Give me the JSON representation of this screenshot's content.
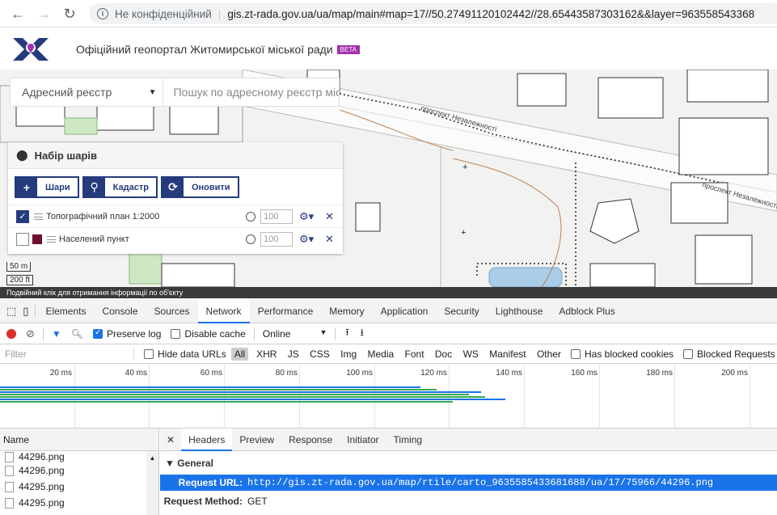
{
  "browser": {
    "security_label": "Не конфіденційний",
    "url": "gis.zt-rada.gov.ua/ua/map/main#map=17//50.27491120102442//28.65443587303162&&layer=963558543368"
  },
  "header": {
    "title": "Офіційний геопортал Житомирської міської ради",
    "badge": "BETA"
  },
  "map": {
    "register_select": "Адресний реєстр",
    "search_placeholder": "Пошук по адресному реєстр міс",
    "street_labels": [
      "проспект Незалежності",
      "проспект Незалежності"
    ],
    "layers_panel": {
      "title": "Набір шарів",
      "buttons": [
        "Шари",
        "Кадастр",
        "Оновити"
      ],
      "layers": [
        {
          "name": "Топографічний план 1:2000",
          "opacity": "100",
          "checked": true
        },
        {
          "name": "Населений пункт",
          "opacity": "100",
          "checked": false,
          "color": "#6b0f2b"
        }
      ]
    },
    "scale": {
      "metric": "50 m",
      "imperial": "200 ft"
    },
    "hint": "Подвійний клік для отримання інформації по об'єкту"
  },
  "devtools": {
    "tabs": [
      "Elements",
      "Console",
      "Sources",
      "Network",
      "Performance",
      "Memory",
      "Application",
      "Security",
      "Lighthouse",
      "Adblock Plus"
    ],
    "active_tab": "Network",
    "toolbar": {
      "preserve_log": "Preserve log",
      "disable_cache": "Disable cache",
      "throttling": "Online"
    },
    "filter": {
      "placeholder": "Filter",
      "hide_data_urls": "Hide data URLs",
      "all": "All",
      "types": [
        "XHR",
        "JS",
        "CSS",
        "Img",
        "Media",
        "Font",
        "Doc",
        "WS",
        "Manifest",
        "Other"
      ],
      "has_blocked_cookies": "Has blocked cookies",
      "blocked_requests": "Blocked Requests"
    },
    "timeline_ticks": [
      "20 ms",
      "40 ms",
      "60 ms",
      "80 ms",
      "100 ms",
      "120 ms",
      "140 ms",
      "160 ms",
      "180 ms",
      "200 ms"
    ],
    "name_header": "Name",
    "requests": [
      "44296.png",
      "44296.png",
      "44295.png",
      "44295.png"
    ],
    "detail_tabs": [
      "Headers",
      "Preview",
      "Response",
      "Initiator",
      "Timing"
    ],
    "active_detail_tab": "Headers",
    "general_label": "▼ General",
    "request_url_label": "Request URL:",
    "request_url": "http://gis.zt-rada.gov.ua/map/rtile/carto_9635585433681688/ua/17/75966/44296.png",
    "request_method_label": "Request Method:",
    "request_method": "GET"
  }
}
